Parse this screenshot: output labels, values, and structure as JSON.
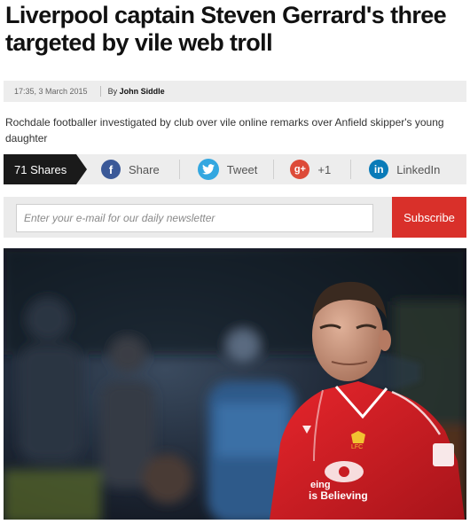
{
  "article": {
    "headline_line1": "Liverpool captain Steven Gerrard's three",
    "headline_line2": "targeted by vile web troll",
    "timestamp": "17:35, 3 March 2015",
    "author_prefix": "By",
    "author": "John Siddle",
    "standfirst": "Rochdale footballer investigated by club over vile online remarks over Anfield skipper's young daughter"
  },
  "share": {
    "count_label": "71 Shares",
    "buttons": [
      {
        "label": "Share",
        "icon": "facebook-icon",
        "glyph": "f",
        "color": "#3b5998"
      },
      {
        "label": "Tweet",
        "icon": "twitter-icon",
        "glyph": "t",
        "color": "#33a7e0"
      },
      {
        "label": "+1",
        "icon": "googleplus-icon",
        "glyph": "g+",
        "color": "#dd4b39"
      },
      {
        "label": "LinkedIn",
        "icon": "linkedin-icon",
        "glyph": "in",
        "color": "#0a7bb8"
      }
    ]
  },
  "newsletter": {
    "placeholder": "Enter your e-mail for our daily newsletter",
    "button_label": "Subscribe"
  },
  "photo": {
    "shirt_text_line1": "eing",
    "shirt_text_line2": "is Believing",
    "crest_text": "LFC"
  },
  "colors": {
    "subscribe": "#d9302a",
    "shirt": "#d81f25"
  }
}
